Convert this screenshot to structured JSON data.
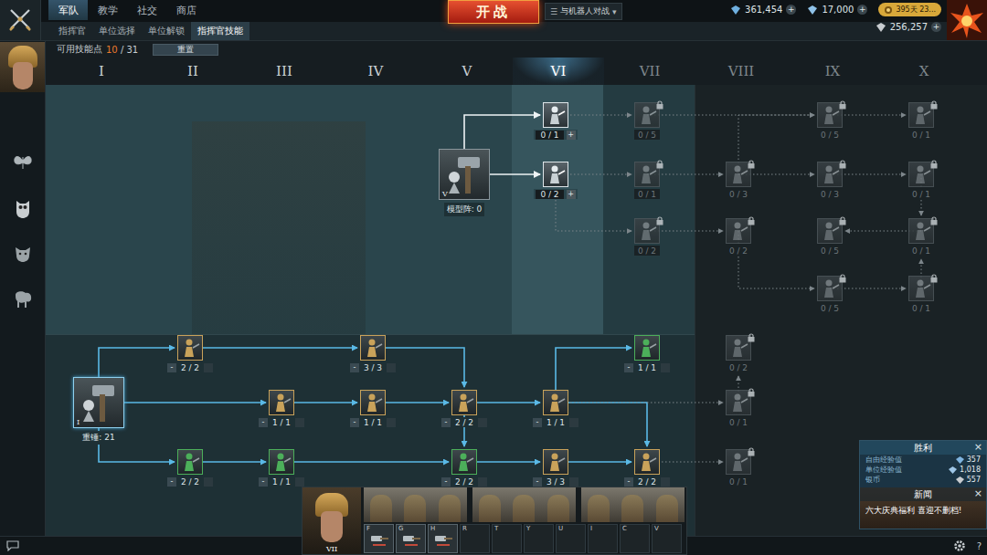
{
  "main_tabs": [
    {
      "label": "军队",
      "selected": true
    },
    {
      "label": "教学",
      "selected": false
    },
    {
      "label": "社交",
      "selected": false
    },
    {
      "label": "商店",
      "selected": false
    }
  ],
  "battle_button": "开战",
  "mode_dropdown": {
    "icon": "☰",
    "label": "与机器人对战",
    "arrow": "▾"
  },
  "currency_rows": [
    [
      {
        "kind": "resource",
        "value": "361,454",
        "plus": "+",
        "color": "#6fb0e0"
      },
      {
        "kind": "resource",
        "value": "17,000",
        "plus": "+",
        "color": "#8fc2e8"
      },
      {
        "kind": "badge",
        "value": "395天 23...",
        "color": "#d8a83a"
      }
    ],
    [
      {
        "kind": "resource",
        "value": "256,257",
        "plus": "+",
        "color": "#c8ccd0"
      }
    ]
  ],
  "sub_tabs": [
    {
      "label": "指挥官",
      "selected": false
    },
    {
      "label": "单位选择",
      "selected": false
    },
    {
      "label": "单位解锁",
      "selected": false
    },
    {
      "label": "指挥官技能",
      "selected": true
    }
  ],
  "skill_points": {
    "label": "可用技能点",
    "available": "10",
    "separator": " / ",
    "total": "31",
    "reset": "重置"
  },
  "columns": [
    {
      "label": "I",
      "selected": false,
      "locked": false
    },
    {
      "label": "II",
      "selected": false,
      "locked": false
    },
    {
      "label": "III",
      "selected": false,
      "locked": false
    },
    {
      "label": "IV",
      "selected": false,
      "locked": false
    },
    {
      "label": "V",
      "selected": false,
      "locked": false
    },
    {
      "label": "VI",
      "selected": true,
      "locked": false
    },
    {
      "label": "VII",
      "selected": false,
      "locked": true
    },
    {
      "label": "VIII",
      "selected": false,
      "locked": true
    },
    {
      "label": "IX",
      "selected": false,
      "locked": true
    },
    {
      "label": "X",
      "selected": false,
      "locked": true
    }
  ],
  "skill_trees": [
    {
      "root": {
        "label": "模型阵: 0",
        "tier": "V",
        "state": "available"
      },
      "nodes": [
        {
          "count": "0 / 1",
          "state": "available",
          "plus": "+"
        },
        {
          "count": "0 / 2",
          "state": "available",
          "plus": "+"
        },
        {
          "count": "0 / 5",
          "state": "locked"
        },
        {
          "count": "0 / 1",
          "state": "locked"
        },
        {
          "count": "0 / 2",
          "state": "locked"
        },
        {
          "count": "0 / 3",
          "state": "locked"
        },
        {
          "count": "0 / 2",
          "state": "locked"
        },
        {
          "count": "0 / 5",
          "state": "locked"
        },
        {
          "count": "0 / 3",
          "state": "locked"
        },
        {
          "count": "0 / 5",
          "state": "locked"
        },
        {
          "count": "0 / 5",
          "state": "locked"
        },
        {
          "count": "0 / 1",
          "state": "locked"
        },
        {
          "count": "0 / 1",
          "state": "locked"
        },
        {
          "count": "0 / 1",
          "state": "locked"
        },
        {
          "count": "0 / 1",
          "state": "locked"
        }
      ]
    },
    {
      "root": {
        "label": "重锤: 21",
        "tier": "I",
        "state": "learned"
      },
      "nodes": [
        {
          "count": "2 / 2",
          "state": "learned",
          "minus": "-",
          "color": "#c9a25a"
        },
        {
          "count": "2 / 2",
          "state": "learned",
          "minus": "-",
          "color": "#4caf5a"
        },
        {
          "count": "1 / 1",
          "state": "learned",
          "minus": "-",
          "color": "#c9a25a"
        },
        {
          "count": "1 / 1",
          "state": "learned",
          "minus": "-",
          "color": "#4caf5a"
        },
        {
          "count": "3 / 3",
          "state": "learned",
          "minus": "-",
          "color": "#c9a25a"
        },
        {
          "count": "1 / 1",
          "state": "learned",
          "minus": "-",
          "color": "#c9a25a"
        },
        {
          "count": "2 / 2",
          "state": "learned",
          "minus": "-",
          "color": "#c9a25a"
        },
        {
          "count": "2 / 2",
          "state": "learned",
          "minus": "-",
          "color": "#4caf5a"
        },
        {
          "count": "1 / 1",
          "state": "learned",
          "minus": "-",
          "color": "#c9a25a"
        },
        {
          "count": "3 / 3",
          "state": "learned",
          "minus": "-",
          "color": "#c9a25a"
        },
        {
          "count": "1 / 1",
          "state": "learned",
          "minus": "-",
          "color": "#4caf5a"
        },
        {
          "count": "2 / 2",
          "state": "learned",
          "minus": "-",
          "color": "#c9a25a"
        },
        {
          "count": "0 / 2",
          "state": "locked"
        },
        {
          "count": "0 / 1",
          "state": "locked"
        },
        {
          "count": "0 / 1",
          "state": "locked"
        }
      ]
    }
  ],
  "unit_bar": {
    "commander_tier": "VII",
    "unit_cards": [
      {
        "filled": true
      },
      {
        "filled": true
      },
      {
        "filled": true
      }
    ],
    "hotkeys": [
      {
        "key": "F",
        "filled": true
      },
      {
        "key": "G",
        "filled": true
      },
      {
        "key": "H",
        "filled": true
      },
      {
        "key": "R",
        "filled": false
      },
      {
        "key": "T",
        "filled": false
      },
      {
        "key": "Y",
        "filled": false
      },
      {
        "key": "U",
        "filled": false
      },
      {
        "key": "I",
        "filled": false
      },
      {
        "key": "C",
        "filled": false
      },
      {
        "key": "V",
        "filled": false
      }
    ]
  },
  "result_panel": {
    "title": "胜利",
    "close": "×",
    "rows": [
      {
        "label": "自由经验值",
        "value": "357",
        "color": "#7fb4e0"
      },
      {
        "label": "单位经验值",
        "value": "1,018",
        "color": "#9fc6e6"
      },
      {
        "label": "银币",
        "value": "557",
        "color": "#c8ccd0"
      }
    ]
  },
  "news": {
    "title": "新闻",
    "close": "×",
    "text": "六大庆典福利 喜迎不删档!"
  },
  "footer": {
    "help": "?"
  }
}
